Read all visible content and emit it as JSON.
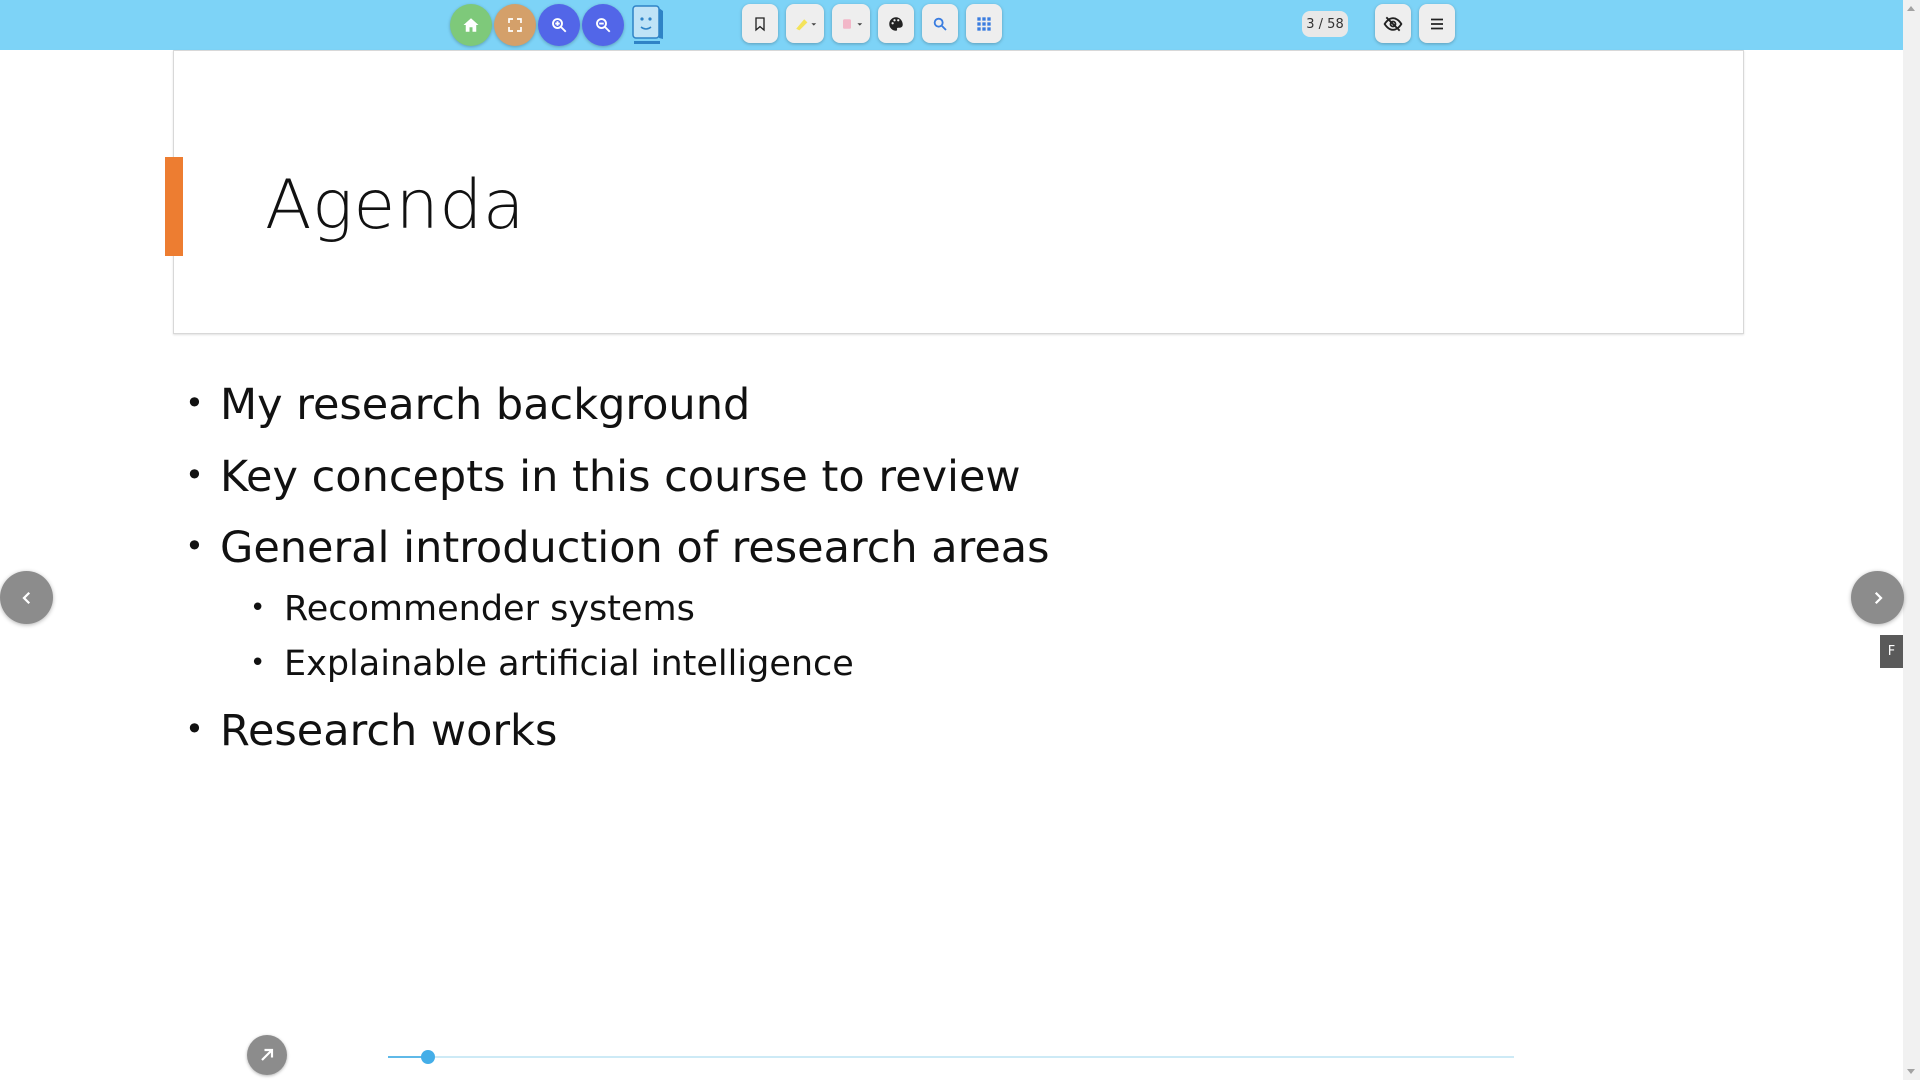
{
  "toolbar": {
    "bg": "#7dd3f7",
    "page_current": "3",
    "page_total": "58",
    "page_label": "3 / 58",
    "buttons": [
      {
        "name": "home-icon",
        "color": "#7ec97a"
      },
      {
        "name": "fullscreen-icon",
        "color": "#d4a06a"
      },
      {
        "name": "zoom-in-icon",
        "color": "#5266e8"
      },
      {
        "name": "zoom-out-icon",
        "color": "#5266e8"
      }
    ]
  },
  "slide": {
    "title": "Agenda",
    "accent_color": "#ed7d31",
    "bullets": [
      {
        "level": 1,
        "text": "My research background"
      },
      {
        "level": 1,
        "text": "Key concepts in this course to review"
      },
      {
        "level": 1,
        "text": "General introduction of research areas"
      },
      {
        "level": 2,
        "text": "Recommender systems"
      },
      {
        "level": 2,
        "text": "Explainable artificial intelligence"
      },
      {
        "level": 1,
        "text": "Research works"
      }
    ]
  },
  "side_tab": {
    "label": "F"
  },
  "progress": {
    "current": 3,
    "total": 58
  }
}
